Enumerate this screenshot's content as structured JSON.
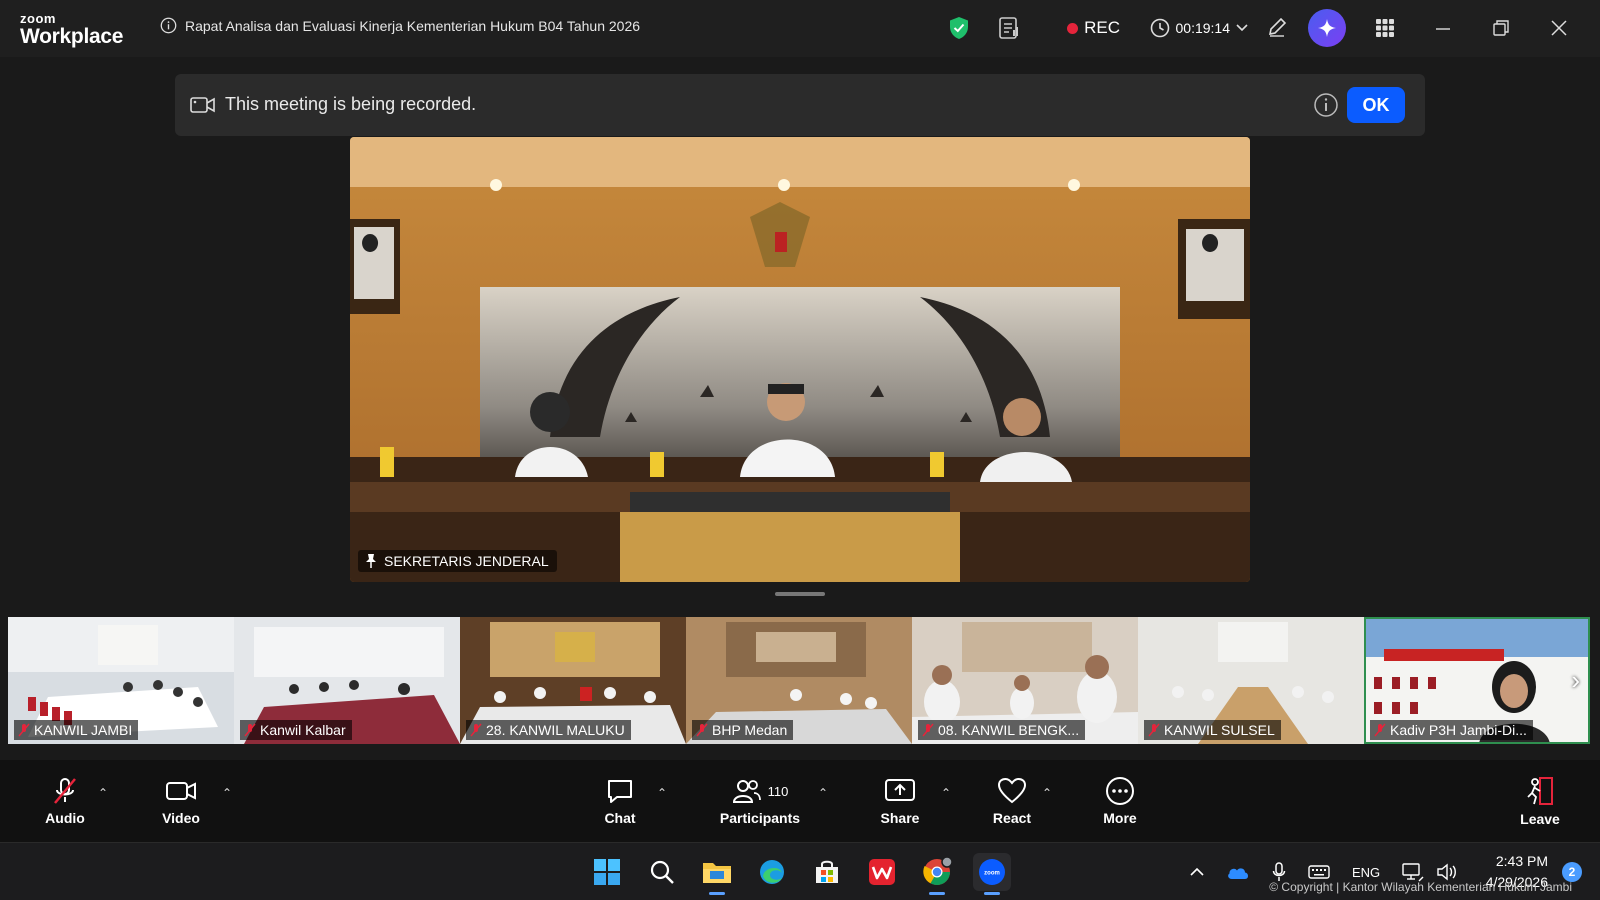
{
  "app": {
    "logo_line1": "zoom",
    "logo_line2": "Workplace",
    "meeting_title": "Rapat Analisa dan Evaluasi Kinerja Kementerian Hukum B04 Tahun 2026",
    "rec_label": "REC",
    "timer": "00:19:14"
  },
  "banner": {
    "message": "This meeting is being recorded.",
    "ok_label": "OK"
  },
  "main_video": {
    "speaker": "SEKRETARIS JENDERAL"
  },
  "thumbnails": [
    {
      "name": "KANWIL JAMBI",
      "muted": true
    },
    {
      "name": "Kanwil Kalbar",
      "muted": true
    },
    {
      "name": "28. KANWIL MALUKU",
      "muted": true
    },
    {
      "name": "BHP Medan",
      "muted": true
    },
    {
      "name": "08. KANWIL BENGK...",
      "muted": true
    },
    {
      "name": "KANWIL SULSEL",
      "muted": true
    },
    {
      "name": "Kadiv P3H Jambi-Di...",
      "muted": true
    }
  ],
  "toolbar": {
    "audio": "Audio",
    "video": "Video",
    "chat": "Chat",
    "participants": "Participants",
    "participants_count": "110",
    "share": "Share",
    "react": "React",
    "more": "More",
    "leave": "Leave"
  },
  "taskbar": {
    "lang": "ENG",
    "time": "2:43 PM",
    "date": "4/29/2026",
    "notifications": "2"
  },
  "watermark": "© Copyright | Kantor Wilayah Kementerian Hukum Jambi",
  "colors": {
    "accent_blue": "#0b5cff",
    "rec_red": "#e5243b",
    "shield_green": "#1fbf6b",
    "muted_red": "#e5243b"
  }
}
